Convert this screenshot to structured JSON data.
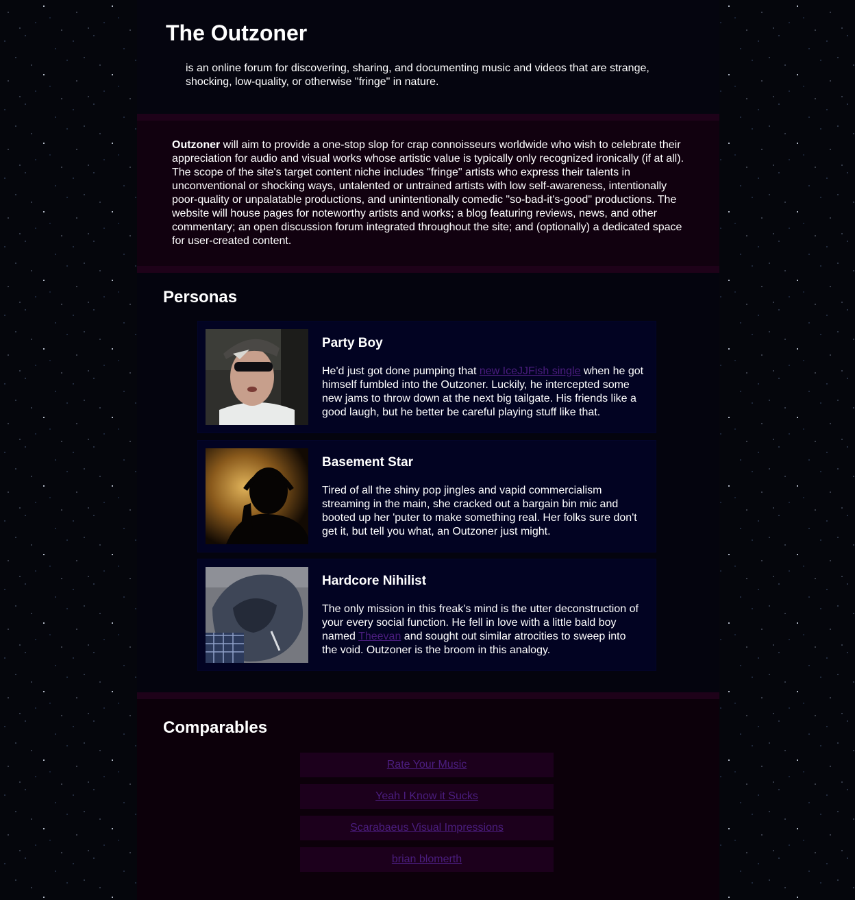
{
  "header": {
    "title": "The Outzoner",
    "tagline": "is an online forum for discovering, sharing, and documenting music and videos that are strange, shocking, low-quality, or otherwise \"fringe\" in nature."
  },
  "intro": {
    "bold_lead": "Outzoner",
    "text": " will aim to provide a one-stop slop for crap connoisseurs worldwide who wish to celebrate their appreciation for audio and visual works whose artistic value is typically only recognized ironically (if at all). The scope of the site's target content niche includes \"fringe\" artists who express their talents in unconventional or shocking ways, untalented or untrained artists with low self-awareness, intentionally poor-quality or unpalatable productions, and unintentionally comedic \"so-bad-it's-good\" productions. The website will house pages for noteworthy artists and works; a blog featuring reviews, news, and other commentary; an open discussion forum integrated throughout the site; and (optionally) a dedicated space for user-created content."
  },
  "personas": {
    "heading": "Personas",
    "items": [
      {
        "name": "Party Boy",
        "desc_before": "He'd just got done pumping that ",
        "link": "new IceJJFish single",
        "desc_after": " when he got himself fumbled into the Outzoner. Luckily, he intercepted some new jams to throw down at the next big tailgate. His friends like a good laugh, but he better be careful playing stuff like that."
      },
      {
        "name": "Basement Star",
        "desc_before": "Tired of all the shiny pop jingles and vapid commercialism streaming in the main, she cracked out a bargain bin mic and booted up her 'puter to make something real. Her folks sure don't get it, but tell you what, an Outzoner just might.",
        "link": "",
        "desc_after": ""
      },
      {
        "name": "Hardcore Nihilist",
        "desc_before": "The only mission in this freak's mind is the utter deconstruction of your every social function. He fell in love with a little bald boy named ",
        "link": "Theevan",
        "desc_after": " and sought out similar atrocities to sweep into the void. Outzoner is the broom in this analogy."
      }
    ]
  },
  "comparables": {
    "heading": "Comparables",
    "links": [
      "Rate Your Music",
      "Yeah I Know it Sucks",
      "Scarabaeus Visual Impressions",
      "brian blomerth"
    ]
  },
  "colors": {
    "link": "#4b1d7f",
    "persona_card_bg": "#020322",
    "intro_bg": "#11010f",
    "comparables_bg": "#0c000a"
  }
}
